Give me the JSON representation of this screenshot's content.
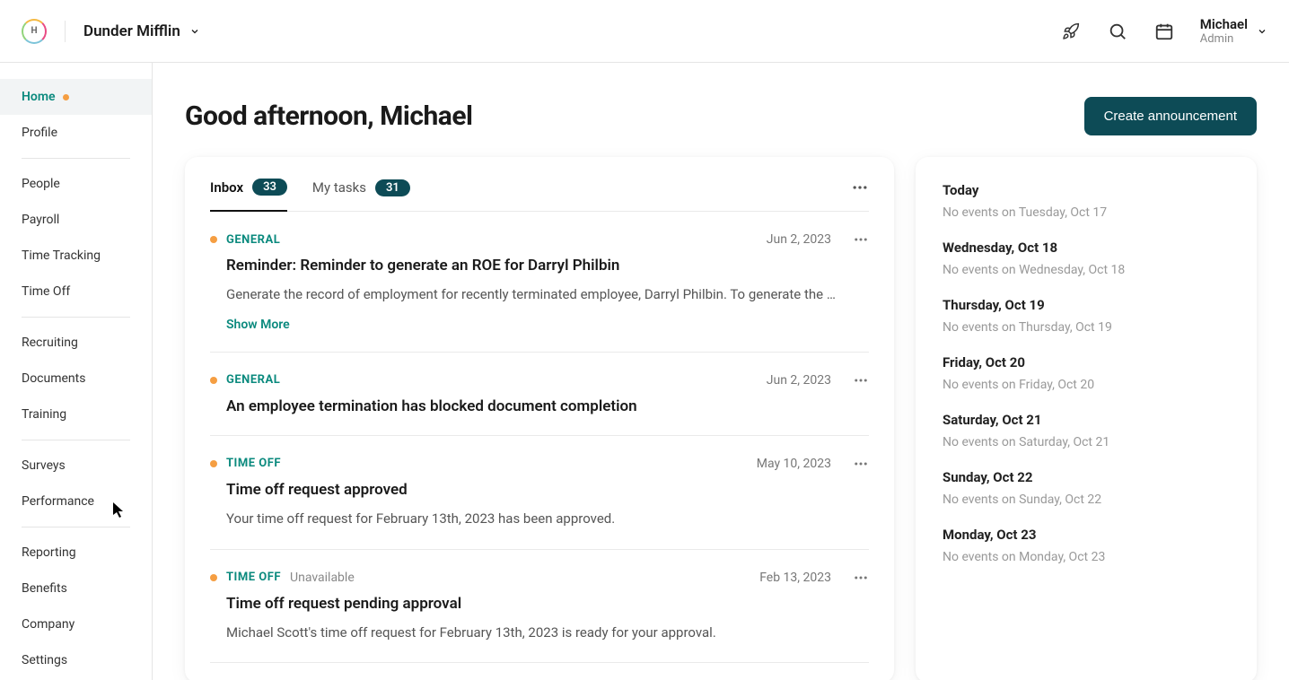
{
  "header": {
    "workspace_name": "Dunder Mifflin",
    "user_name": "Michael",
    "user_role": "Admin"
  },
  "sidebar": {
    "groups": [
      {
        "items": [
          {
            "label": "Home",
            "active": true,
            "has_dot": true
          },
          {
            "label": "Profile"
          }
        ]
      },
      {
        "items": [
          {
            "label": "People"
          },
          {
            "label": "Payroll"
          },
          {
            "label": "Time Tracking"
          },
          {
            "label": "Time Off"
          }
        ]
      },
      {
        "items": [
          {
            "label": "Recruiting"
          },
          {
            "label": "Documents"
          },
          {
            "label": "Training"
          }
        ]
      },
      {
        "items": [
          {
            "label": "Surveys"
          },
          {
            "label": "Performance"
          }
        ]
      },
      {
        "items": [
          {
            "label": "Reporting"
          },
          {
            "label": "Benefits"
          },
          {
            "label": "Company"
          },
          {
            "label": "Settings"
          }
        ]
      }
    ]
  },
  "page": {
    "title": "Good afternoon, Michael",
    "create_announcement_label": "Create announcement"
  },
  "tabs": {
    "inbox_label": "Inbox",
    "inbox_count": "33",
    "mytasks_label": "My tasks",
    "mytasks_count": "31"
  },
  "inbox": [
    {
      "category": "GENERAL",
      "date": "Jun 2, 2023",
      "title": "Reminder: Reminder to generate an ROE for Darryl Philbin",
      "body": "Generate the record of employment for recently terminated employee, Darryl Philbin. To generate the …",
      "show_more": "Show More"
    },
    {
      "category": "GENERAL",
      "date": "Jun 2, 2023",
      "title": "An employee termination has blocked document completion"
    },
    {
      "category": "TIME OFF",
      "date": "May 10, 2023",
      "title": "Time off request approved",
      "body": "Your time off request for February 13th, 2023 has been approved."
    },
    {
      "category": "TIME OFF",
      "subcategory": "Unavailable",
      "date": "Feb 13, 2023",
      "title": "Time off request pending approval",
      "body": "Michael Scott's time off request for February 13th, 2023 is ready for your approval."
    }
  ],
  "events": [
    {
      "date": "Today",
      "empty_text": "No events on Tuesday, Oct 17"
    },
    {
      "date": "Wednesday, Oct 18",
      "empty_text": "No events on Wednesday, Oct 18"
    },
    {
      "date": "Thursday, Oct 19",
      "empty_text": "No events on Thursday, Oct 19"
    },
    {
      "date": "Friday, Oct 20",
      "empty_text": "No events on Friday, Oct 20"
    },
    {
      "date": "Saturday, Oct 21",
      "empty_text": "No events on Saturday, Oct 21"
    },
    {
      "date": "Sunday, Oct 22",
      "empty_text": "No events on Sunday, Oct 22"
    },
    {
      "date": "Monday, Oct 23",
      "empty_text": "No events on Monday, Oct 23"
    }
  ]
}
